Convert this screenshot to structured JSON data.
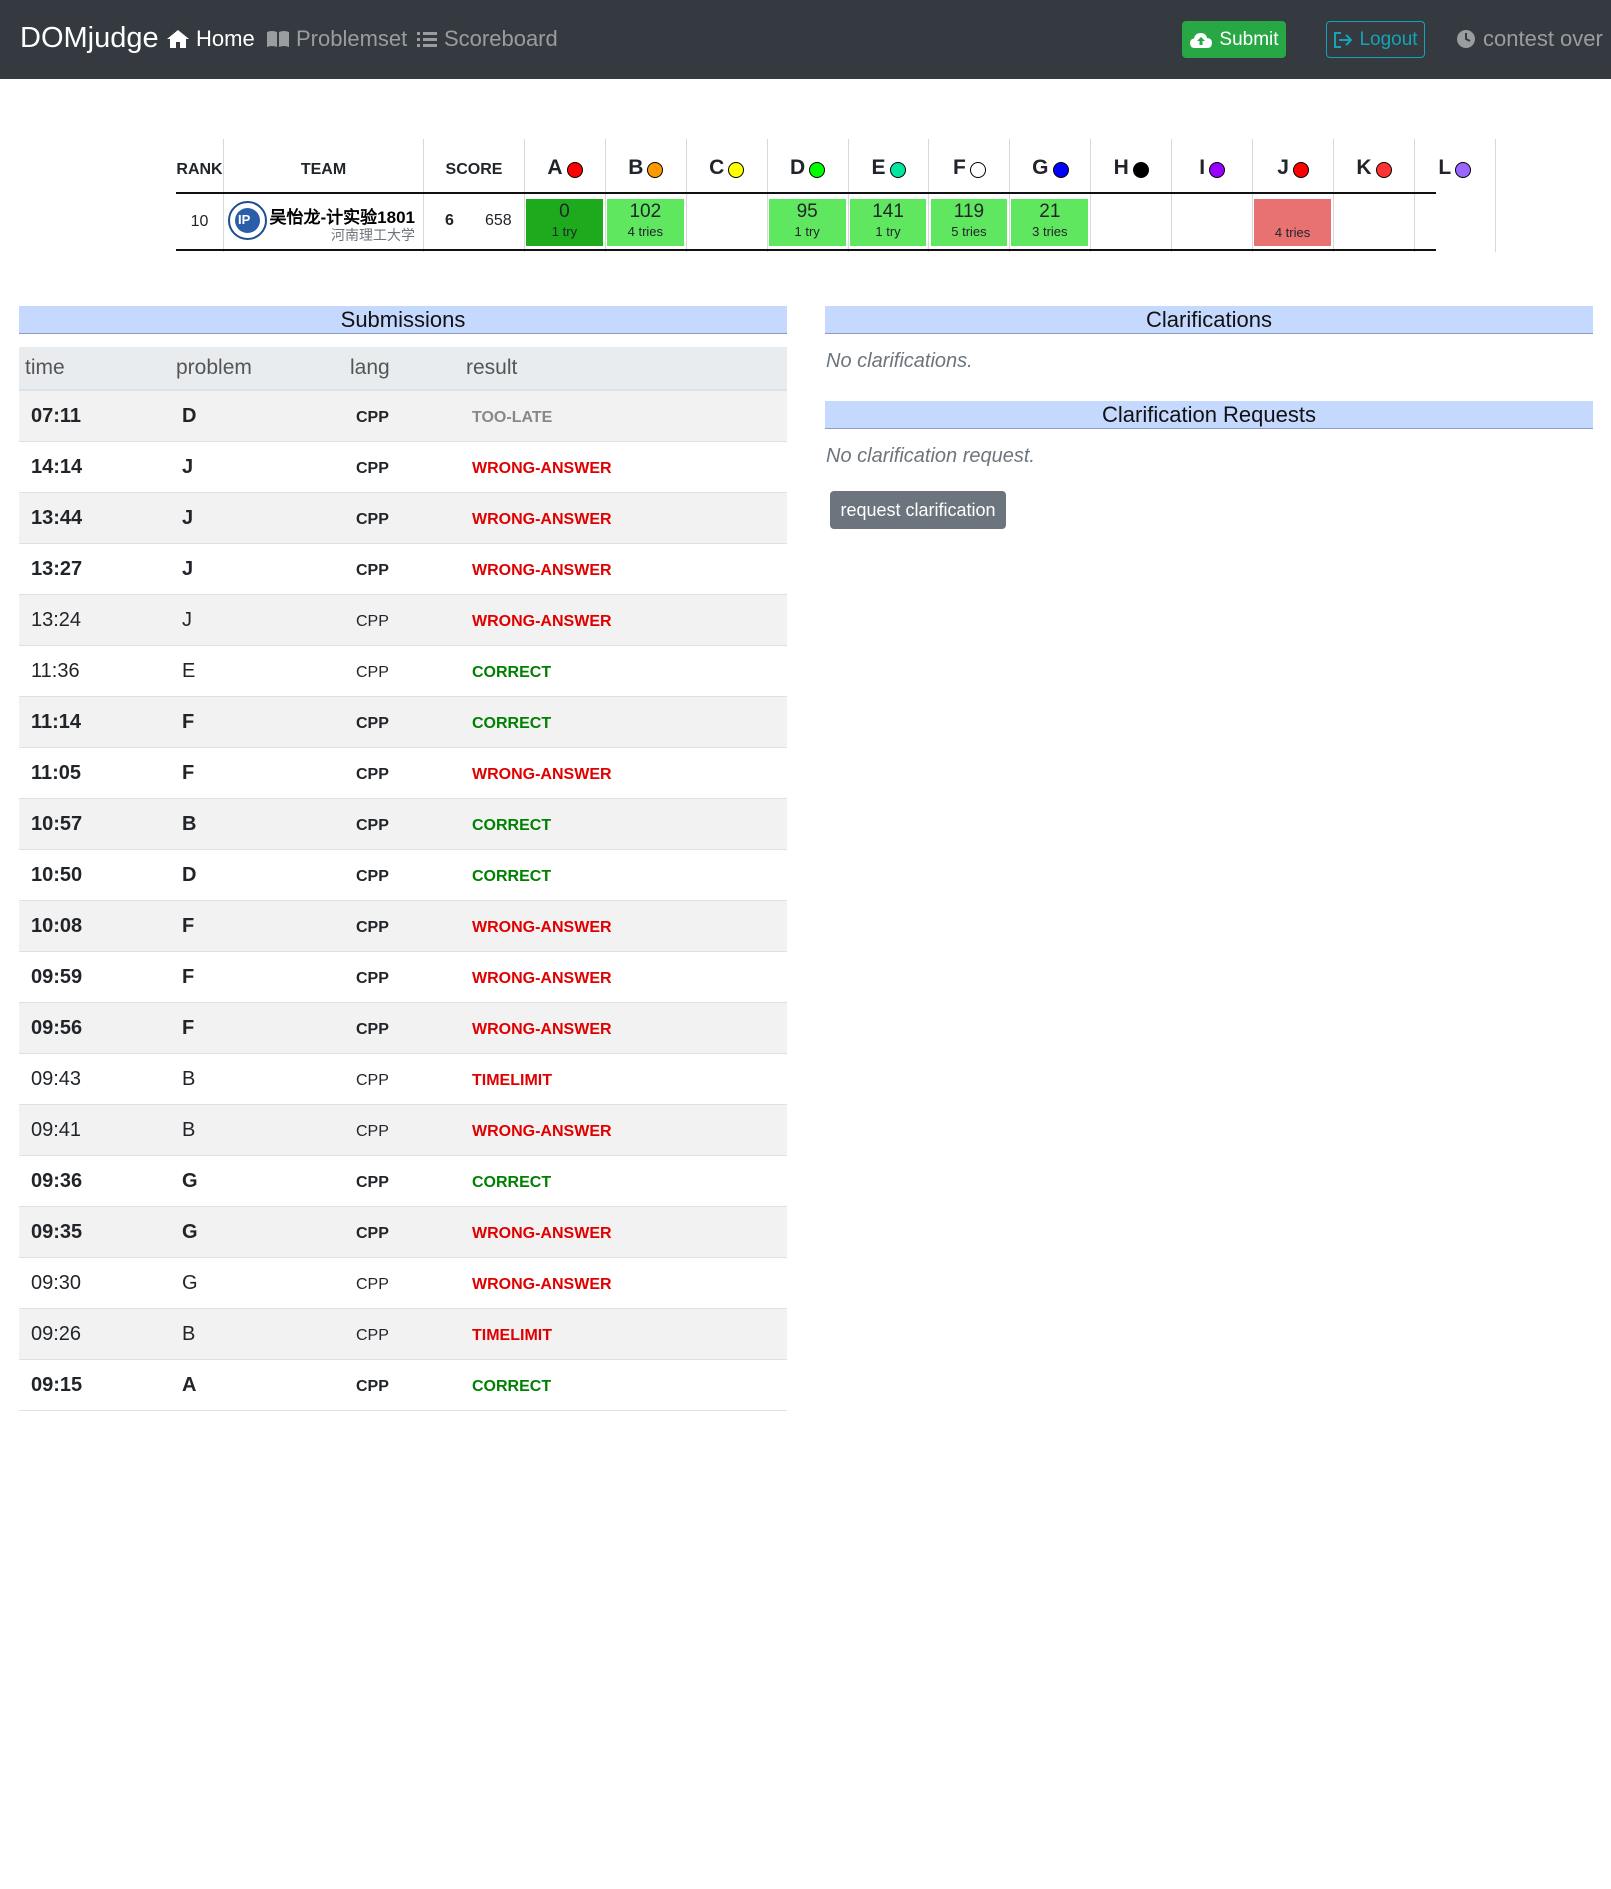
{
  "navbar": {
    "brand": "DOMjudge",
    "home": "Home",
    "problemset": "Problemset",
    "scoreboard": "Scoreboard",
    "submit": "Submit",
    "logout": "Logout",
    "status": "contest over",
    "colors": {
      "background": "#343a40",
      "submit": "#28a745",
      "logout": "#17a2b8"
    }
  },
  "scoreboard": {
    "headers": {
      "rank": "RANK",
      "team": "TEAM",
      "score": "SCORE"
    },
    "row": {
      "rank": "10",
      "team_name": "吴怡龙-计实验1801",
      "affiliation": "河南理工大学",
      "solved": "6",
      "penalty": "658"
    },
    "problems": [
      {
        "label": "A",
        "color": "#ff0000",
        "time": "0",
        "tries": "1 try",
        "status": "first"
      },
      {
        "label": "B",
        "color": "#ff9900",
        "time": "102",
        "tries": "4 tries",
        "status": "correct"
      },
      {
        "label": "C",
        "color": "#ffff00",
        "time": "",
        "tries": "",
        "status": "none"
      },
      {
        "label": "D",
        "color": "#00ff00",
        "time": "95",
        "tries": "1 try",
        "status": "correct"
      },
      {
        "label": "E",
        "color": "#00e6a0",
        "time": "141",
        "tries": "1 try",
        "status": "correct"
      },
      {
        "label": "F",
        "color": "#ffffff",
        "time": "119",
        "tries": "5 tries",
        "status": "correct"
      },
      {
        "label": "G",
        "color": "#0000ff",
        "time": "21",
        "tries": "3 tries",
        "status": "correct"
      },
      {
        "label": "H",
        "color": "#000000",
        "time": "",
        "tries": "",
        "status": "none"
      },
      {
        "label": "I",
        "color": "#9900ff",
        "time": "",
        "tries": "",
        "status": "none"
      },
      {
        "label": "J",
        "color": "#ff0000",
        "time": "",
        "tries": "4 tries",
        "status": "incorrect"
      },
      {
        "label": "K",
        "color": "#ff3333",
        "time": "",
        "tries": "",
        "status": "none"
      },
      {
        "label": "L",
        "color": "#9966ff",
        "time": "",
        "tries": "",
        "status": "none"
      }
    ],
    "status_colors": {
      "first": "#1daa1d",
      "correct": "#60e760",
      "incorrect": "#e87272"
    }
  },
  "submissions": {
    "title": "Submissions",
    "columns": {
      "time": "time",
      "problem": "problem",
      "lang": "lang",
      "result": "result"
    },
    "rows": [
      {
        "time": "07:11",
        "problem": "D",
        "lang": "CPP",
        "result": "TOO-LATE",
        "kind": "late",
        "bold": true
      },
      {
        "time": "14:14",
        "problem": "J",
        "lang": "CPP",
        "result": "WRONG-ANSWER",
        "kind": "wrong",
        "bold": true
      },
      {
        "time": "13:44",
        "problem": "J",
        "lang": "CPP",
        "result": "WRONG-ANSWER",
        "kind": "wrong",
        "bold": true
      },
      {
        "time": "13:27",
        "problem": "J",
        "lang": "CPP",
        "result": "WRONG-ANSWER",
        "kind": "wrong",
        "bold": true
      },
      {
        "time": "13:24",
        "problem": "J",
        "lang": "CPP",
        "result": "WRONG-ANSWER",
        "kind": "wrong",
        "bold": false
      },
      {
        "time": "11:36",
        "problem": "E",
        "lang": "CPP",
        "result": "CORRECT",
        "kind": "correct",
        "bold": false
      },
      {
        "time": "11:14",
        "problem": "F",
        "lang": "CPP",
        "result": "CORRECT",
        "kind": "correct",
        "bold": true
      },
      {
        "time": "11:05",
        "problem": "F",
        "lang": "CPP",
        "result": "WRONG-ANSWER",
        "kind": "wrong",
        "bold": true
      },
      {
        "time": "10:57",
        "problem": "B",
        "lang": "CPP",
        "result": "CORRECT",
        "kind": "correct",
        "bold": true
      },
      {
        "time": "10:50",
        "problem": "D",
        "lang": "CPP",
        "result": "CORRECT",
        "kind": "correct",
        "bold": true
      },
      {
        "time": "10:08",
        "problem": "F",
        "lang": "CPP",
        "result": "WRONG-ANSWER",
        "kind": "wrong",
        "bold": true
      },
      {
        "time": "09:59",
        "problem": "F",
        "lang": "CPP",
        "result": "WRONG-ANSWER",
        "kind": "wrong",
        "bold": true
      },
      {
        "time": "09:56",
        "problem": "F",
        "lang": "CPP",
        "result": "WRONG-ANSWER",
        "kind": "wrong",
        "bold": true
      },
      {
        "time": "09:43",
        "problem": "B",
        "lang": "CPP",
        "result": "TIMELIMIT",
        "kind": "timelimit",
        "bold": false
      },
      {
        "time": "09:41",
        "problem": "B",
        "lang": "CPP",
        "result": "WRONG-ANSWER",
        "kind": "wrong",
        "bold": false
      },
      {
        "time": "09:36",
        "problem": "G",
        "lang": "CPP",
        "result": "CORRECT",
        "kind": "correct",
        "bold": true
      },
      {
        "time": "09:35",
        "problem": "G",
        "lang": "CPP",
        "result": "WRONG-ANSWER",
        "kind": "wrong",
        "bold": true
      },
      {
        "time": "09:30",
        "problem": "G",
        "lang": "CPP",
        "result": "WRONG-ANSWER",
        "kind": "wrong",
        "bold": false
      },
      {
        "time": "09:26",
        "problem": "B",
        "lang": "CPP",
        "result": "TIMELIMIT",
        "kind": "timelimit",
        "bold": false
      },
      {
        "time": "09:15",
        "problem": "A",
        "lang": "CPP",
        "result": "CORRECT",
        "kind": "correct",
        "bold": true
      }
    ]
  },
  "clarifications": {
    "title": "Clarifications",
    "empty": "No clarifications.",
    "requests_title": "Clarification Requests",
    "requests_empty": "No clarification request.",
    "request_button": "request clarification"
  }
}
